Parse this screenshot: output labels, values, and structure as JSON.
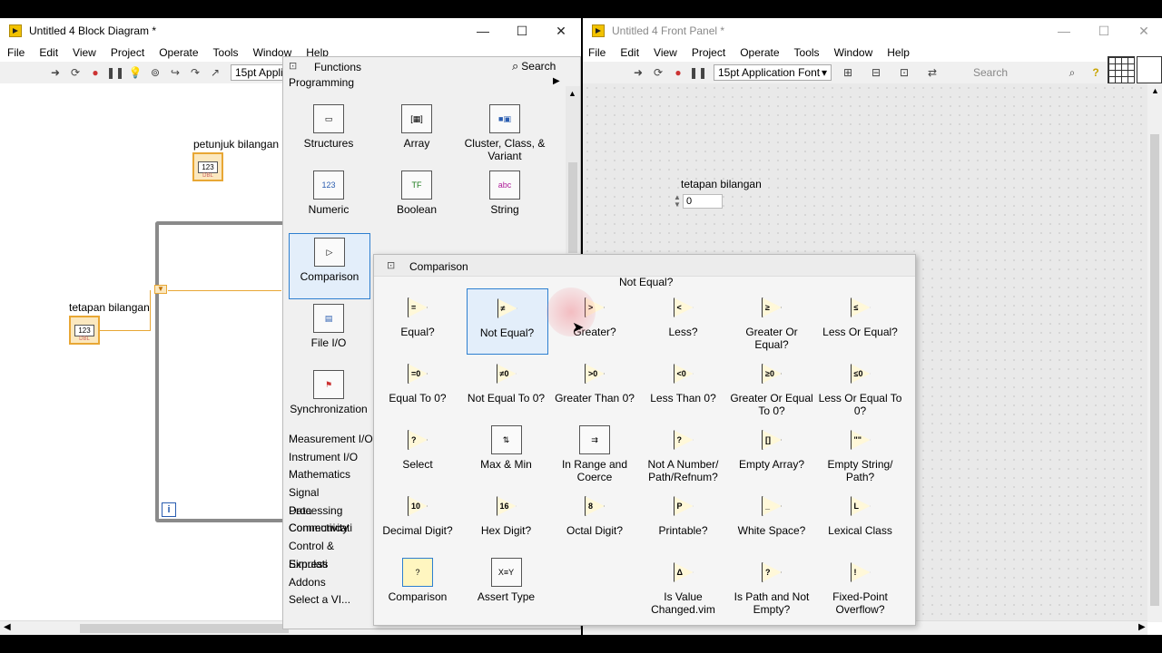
{
  "block_diagram": {
    "title": "Untitled 4 Block Diagram *",
    "menu": [
      "File",
      "Edit",
      "View",
      "Project",
      "Operate",
      "Tools",
      "Window",
      "Help"
    ],
    "font": "15pt Applic",
    "controls": {
      "petunjuk_label": "petunjuk bilangan",
      "tetapan_label": "tetapan bilangan",
      "terminal_text": "123",
      "terminal_type": "DBL",
      "loop_index": "i"
    }
  },
  "front_panel": {
    "title": "Untitled 4 Front Panel *",
    "menu": [
      "File",
      "Edit",
      "View",
      "Project",
      "Operate",
      "Tools",
      "Window",
      "Help"
    ],
    "font": "15pt Application Font",
    "search_placeholder": "Search",
    "control_label": "tetapan bilangan",
    "control_value": "0"
  },
  "functions_palette": {
    "title": "Functions",
    "search_label": "Search",
    "category": "Programming",
    "items": [
      {
        "label": "Structures"
      },
      {
        "label": "Array"
      },
      {
        "label": "Cluster, Class, & Variant"
      },
      {
        "label": "Numeric"
      },
      {
        "label": "Boolean"
      },
      {
        "label": "String"
      },
      {
        "label": "Comparison"
      },
      {
        "label": "File I/O"
      },
      {
        "label": "Synchronization"
      }
    ],
    "subcategories": [
      "Measurement I/O",
      "Instrument I/O",
      "Mathematics",
      "Signal Processing",
      "Data Communicati",
      "Connectivity",
      "Control & Simulati",
      "Express",
      "Addons",
      "Select a VI..."
    ]
  },
  "comparison_palette": {
    "title": "Comparison",
    "tooltip": "Not Equal?",
    "items": [
      {
        "label": "Equal?",
        "glyph": "="
      },
      {
        "label": "Not Equal?",
        "glyph": "≠"
      },
      {
        "label": "Greater?",
        "glyph": ">"
      },
      {
        "label": "Less?",
        "glyph": "<"
      },
      {
        "label": "Greater Or Equal?",
        "glyph": "≥"
      },
      {
        "label": "Less Or Equal?",
        "glyph": "≤"
      },
      {
        "label": "Equal To 0?",
        "glyph": "=0"
      },
      {
        "label": "Not Equal To 0?",
        "glyph": "≠0"
      },
      {
        "label": "Greater Than 0?",
        "glyph": ">0"
      },
      {
        "label": "Less Than 0?",
        "glyph": "<0"
      },
      {
        "label": "Greater Or Equal To 0?",
        "glyph": "≥0"
      },
      {
        "label": "Less Or Equal To 0?",
        "glyph": "≤0"
      },
      {
        "label": "Select",
        "glyph": "?"
      },
      {
        "label": "Max & Min",
        "glyph": "⇅"
      },
      {
        "label": "In Range and Coerce",
        "glyph": "⇉"
      },
      {
        "label": "Not A Number/ Path/Refnum?",
        "glyph": "?"
      },
      {
        "label": "Empty Array?",
        "glyph": "[]"
      },
      {
        "label": "Empty String/ Path?",
        "glyph": "\"\""
      },
      {
        "label": "Decimal Digit?",
        "glyph": "10"
      },
      {
        "label": "Hex Digit?",
        "glyph": "16"
      },
      {
        "label": "Octal Digit?",
        "glyph": "8"
      },
      {
        "label": "Printable?",
        "glyph": "P"
      },
      {
        "label": "White Space?",
        "glyph": "_"
      },
      {
        "label": "Lexical Class",
        "glyph": "L"
      },
      {
        "label": "Comparison",
        "glyph": "?"
      },
      {
        "label": "Assert Type",
        "glyph": "X≡Y"
      },
      {
        "label": "",
        "glyph": ""
      },
      {
        "label": "Is Value Changed.vim",
        "glyph": "Δ"
      },
      {
        "label": "Is Path and Not Empty?",
        "glyph": "?"
      },
      {
        "label": "Fixed-Point Overflow?",
        "glyph": "!"
      }
    ]
  }
}
